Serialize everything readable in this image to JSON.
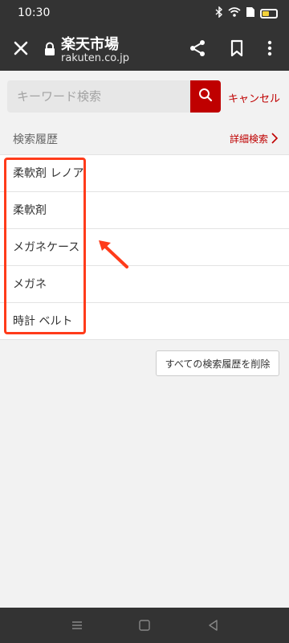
{
  "status_bar": {
    "time": "10:30",
    "battery_level": 0.55,
    "icons": [
      "bluetooth-icon",
      "wifi-icon",
      "sim-icon",
      "battery-icon"
    ]
  },
  "toolbar": {
    "title": "楽天市場",
    "url": "rakuten.co.jp"
  },
  "search": {
    "placeholder": "キーワード検索",
    "value": "",
    "cancel_label": "キャンセル"
  },
  "history": {
    "label": "検索履歴",
    "advanced_search_label": "詳細検索",
    "items": [
      {
        "label": "柔軟剤 レノア"
      },
      {
        "label": "柔軟剤"
      },
      {
        "label": "メガネケース"
      },
      {
        "label": "メガネ"
      },
      {
        "label": "時計 ベルト"
      }
    ],
    "clear_all_label": "すべての検索履歴を削除"
  },
  "colors": {
    "brand_red": "#bf0000",
    "chrome_dark": "#333333",
    "annotation_red": "#ff3b1a"
  }
}
